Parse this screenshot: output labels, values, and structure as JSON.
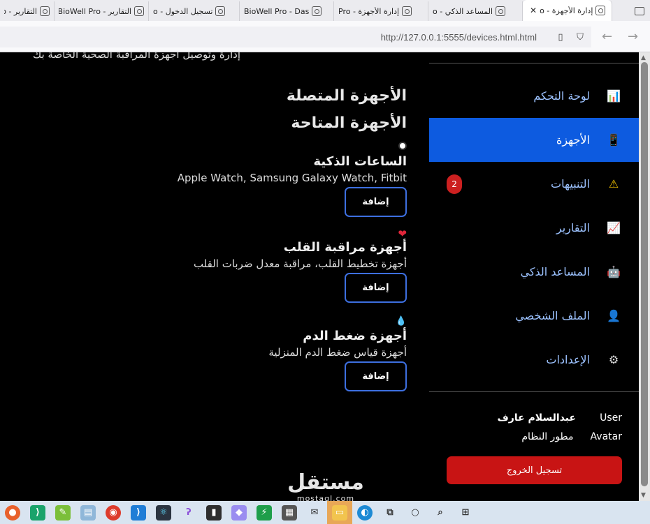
{
  "browser": {
    "tabs": [
      {
        "label": "التقارير - o",
        "active": false
      },
      {
        "label": "التقارير - BioWell Pro",
        "active": false
      },
      {
        "label": "تسجيل الدخول - o",
        "active": false
      },
      {
        "label": "BioWell Pro - Das",
        "active": false
      },
      {
        "label": "إدارة الأجهزة - Pro",
        "active": false
      },
      {
        "label": "المساعد الذكي - o",
        "active": false
      },
      {
        "label": "إدارة الأجهزة - o",
        "active": true
      }
    ],
    "url": "http://127.0.0.1:5555/devices.html.html"
  },
  "main": {
    "intro": "إدارة وتوصيل أجهزة المراقبة الصحية الخاصة بك",
    "connected_title": "الأجهزة المتصلة",
    "available_title": "الأجهزة المتاحة",
    "devices": [
      {
        "icon": "watch-icon",
        "name": "الساعات الذكية",
        "description": "Apple Watch, Samsung Galaxy Watch, Fitbit",
        "button": "إضافة"
      },
      {
        "icon": "heart-icon",
        "name": "أجهزة مراقبة القلب",
        "description": "أجهزة تخطيط القلب، مراقبة معدل ضربات القلب",
        "button": "إضافة"
      },
      {
        "icon": "blood-drop-icon",
        "name": "أجهزة ضغط الدم",
        "description": "أجهزة قياس ضغط الدم المنزلية",
        "button": "إضافة"
      }
    ]
  },
  "sidebar": {
    "items": [
      {
        "label": "لوحة التحكم",
        "icon": "bar-chart-icon",
        "active": false,
        "badge": ""
      },
      {
        "label": "الأجهزة",
        "icon": "mobile-phone-icon",
        "active": true,
        "badge": ""
      },
      {
        "label": "التنبيهات",
        "icon": "warning-icon",
        "active": false,
        "badge": "2"
      },
      {
        "label": "التقارير",
        "icon": "trend-chart-icon",
        "active": false,
        "badge": ""
      },
      {
        "label": "المساعد الذكي",
        "icon": "robot-icon",
        "active": false,
        "badge": ""
      },
      {
        "label": "الملف الشخصي",
        "icon": "user-icon",
        "active": false,
        "badge": ""
      },
      {
        "label": "الإعدادات",
        "icon": "gear-icon",
        "active": false,
        "badge": ""
      }
    ],
    "user": {
      "name": "عبدالسلام عارف",
      "name_alt": "User",
      "role": "مطور النظام",
      "role_alt": "Avatar"
    },
    "logout": "تسجيل الخروج"
  },
  "watermark": {
    "big": "مستقل",
    "small": "mostaql.com"
  }
}
